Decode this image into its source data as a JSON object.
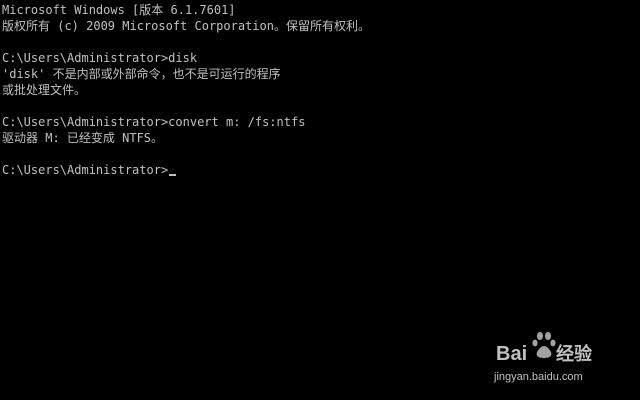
{
  "console": {
    "lines": [
      "Microsoft Windows [版本 6.1.7601]",
      "版权所有 (c) 2009 Microsoft Corporation。保留所有权利。",
      "",
      "C:\\Users\\Administrator>disk",
      "'disk' 不是内部或外部命令，也不是可运行的程序",
      "或批处理文件。",
      "",
      "C:\\Users\\Administrator>convert m: /fs:ntfs",
      "驱动器 M: 已经变成 NTFS。",
      "",
      "C:\\Users\\Administrator>"
    ]
  },
  "watermark": {
    "brand": "Baidu经验",
    "url": "jingyan.baidu.com"
  },
  "colors": {
    "background": "#000000",
    "foreground": "#c0c0c0"
  }
}
